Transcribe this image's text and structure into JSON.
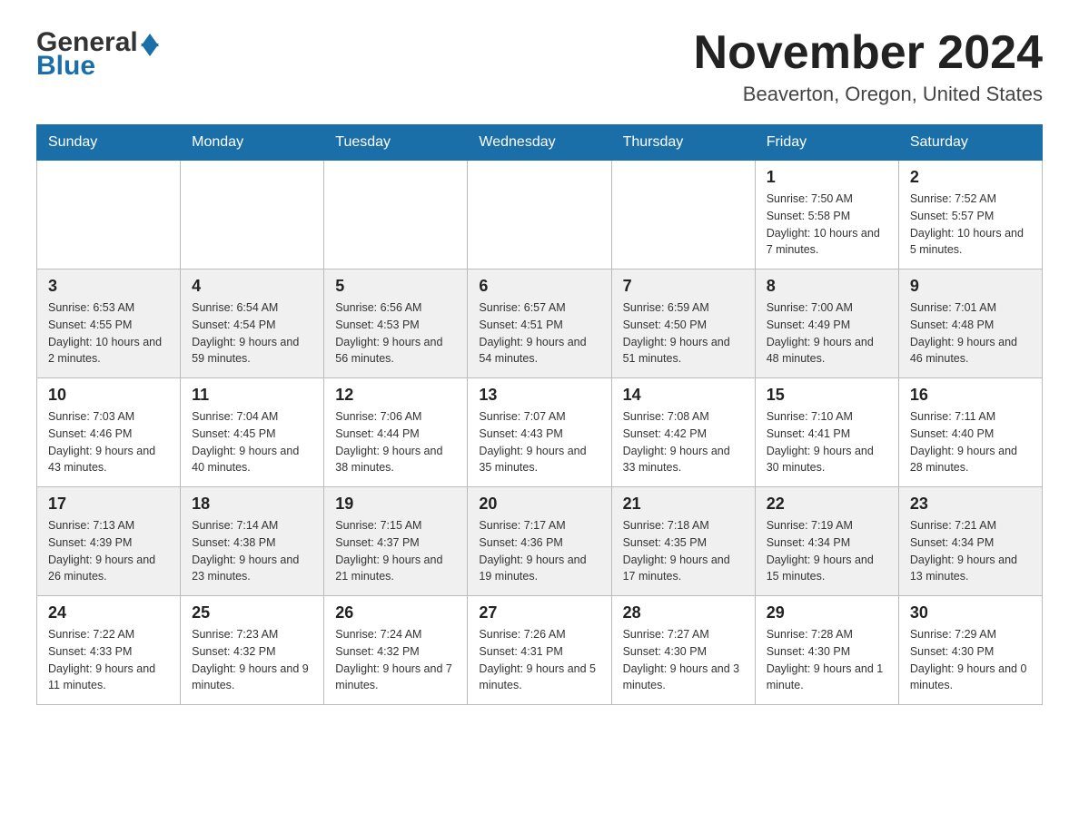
{
  "header": {
    "logo_text_general": "General",
    "logo_text_blue": "Blue",
    "month_title": "November 2024",
    "location": "Beaverton, Oregon, United States"
  },
  "days_of_week": [
    "Sunday",
    "Monday",
    "Tuesday",
    "Wednesday",
    "Thursday",
    "Friday",
    "Saturday"
  ],
  "weeks": [
    [
      {
        "day": "",
        "info": ""
      },
      {
        "day": "",
        "info": ""
      },
      {
        "day": "",
        "info": ""
      },
      {
        "day": "",
        "info": ""
      },
      {
        "day": "",
        "info": ""
      },
      {
        "day": "1",
        "info": "Sunrise: 7:50 AM\nSunset: 5:58 PM\nDaylight: 10 hours and 7 minutes."
      },
      {
        "day": "2",
        "info": "Sunrise: 7:52 AM\nSunset: 5:57 PM\nDaylight: 10 hours and 5 minutes."
      }
    ],
    [
      {
        "day": "3",
        "info": "Sunrise: 6:53 AM\nSunset: 4:55 PM\nDaylight: 10 hours and 2 minutes."
      },
      {
        "day": "4",
        "info": "Sunrise: 6:54 AM\nSunset: 4:54 PM\nDaylight: 9 hours and 59 minutes."
      },
      {
        "day": "5",
        "info": "Sunrise: 6:56 AM\nSunset: 4:53 PM\nDaylight: 9 hours and 56 minutes."
      },
      {
        "day": "6",
        "info": "Sunrise: 6:57 AM\nSunset: 4:51 PM\nDaylight: 9 hours and 54 minutes."
      },
      {
        "day": "7",
        "info": "Sunrise: 6:59 AM\nSunset: 4:50 PM\nDaylight: 9 hours and 51 minutes."
      },
      {
        "day": "8",
        "info": "Sunrise: 7:00 AM\nSunset: 4:49 PM\nDaylight: 9 hours and 48 minutes."
      },
      {
        "day": "9",
        "info": "Sunrise: 7:01 AM\nSunset: 4:48 PM\nDaylight: 9 hours and 46 minutes."
      }
    ],
    [
      {
        "day": "10",
        "info": "Sunrise: 7:03 AM\nSunset: 4:46 PM\nDaylight: 9 hours and 43 minutes."
      },
      {
        "day": "11",
        "info": "Sunrise: 7:04 AM\nSunset: 4:45 PM\nDaylight: 9 hours and 40 minutes."
      },
      {
        "day": "12",
        "info": "Sunrise: 7:06 AM\nSunset: 4:44 PM\nDaylight: 9 hours and 38 minutes."
      },
      {
        "day": "13",
        "info": "Sunrise: 7:07 AM\nSunset: 4:43 PM\nDaylight: 9 hours and 35 minutes."
      },
      {
        "day": "14",
        "info": "Sunrise: 7:08 AM\nSunset: 4:42 PM\nDaylight: 9 hours and 33 minutes."
      },
      {
        "day": "15",
        "info": "Sunrise: 7:10 AM\nSunset: 4:41 PM\nDaylight: 9 hours and 30 minutes."
      },
      {
        "day": "16",
        "info": "Sunrise: 7:11 AM\nSunset: 4:40 PM\nDaylight: 9 hours and 28 minutes."
      }
    ],
    [
      {
        "day": "17",
        "info": "Sunrise: 7:13 AM\nSunset: 4:39 PM\nDaylight: 9 hours and 26 minutes."
      },
      {
        "day": "18",
        "info": "Sunrise: 7:14 AM\nSunset: 4:38 PM\nDaylight: 9 hours and 23 minutes."
      },
      {
        "day": "19",
        "info": "Sunrise: 7:15 AM\nSunset: 4:37 PM\nDaylight: 9 hours and 21 minutes."
      },
      {
        "day": "20",
        "info": "Sunrise: 7:17 AM\nSunset: 4:36 PM\nDaylight: 9 hours and 19 minutes."
      },
      {
        "day": "21",
        "info": "Sunrise: 7:18 AM\nSunset: 4:35 PM\nDaylight: 9 hours and 17 minutes."
      },
      {
        "day": "22",
        "info": "Sunrise: 7:19 AM\nSunset: 4:34 PM\nDaylight: 9 hours and 15 minutes."
      },
      {
        "day": "23",
        "info": "Sunrise: 7:21 AM\nSunset: 4:34 PM\nDaylight: 9 hours and 13 minutes."
      }
    ],
    [
      {
        "day": "24",
        "info": "Sunrise: 7:22 AM\nSunset: 4:33 PM\nDaylight: 9 hours and 11 minutes."
      },
      {
        "day": "25",
        "info": "Sunrise: 7:23 AM\nSunset: 4:32 PM\nDaylight: 9 hours and 9 minutes."
      },
      {
        "day": "26",
        "info": "Sunrise: 7:24 AM\nSunset: 4:32 PM\nDaylight: 9 hours and 7 minutes."
      },
      {
        "day": "27",
        "info": "Sunrise: 7:26 AM\nSunset: 4:31 PM\nDaylight: 9 hours and 5 minutes."
      },
      {
        "day": "28",
        "info": "Sunrise: 7:27 AM\nSunset: 4:30 PM\nDaylight: 9 hours and 3 minutes."
      },
      {
        "day": "29",
        "info": "Sunrise: 7:28 AM\nSunset: 4:30 PM\nDaylight: 9 hours and 1 minute."
      },
      {
        "day": "30",
        "info": "Sunrise: 7:29 AM\nSunset: 4:30 PM\nDaylight: 9 hours and 0 minutes."
      }
    ]
  ]
}
